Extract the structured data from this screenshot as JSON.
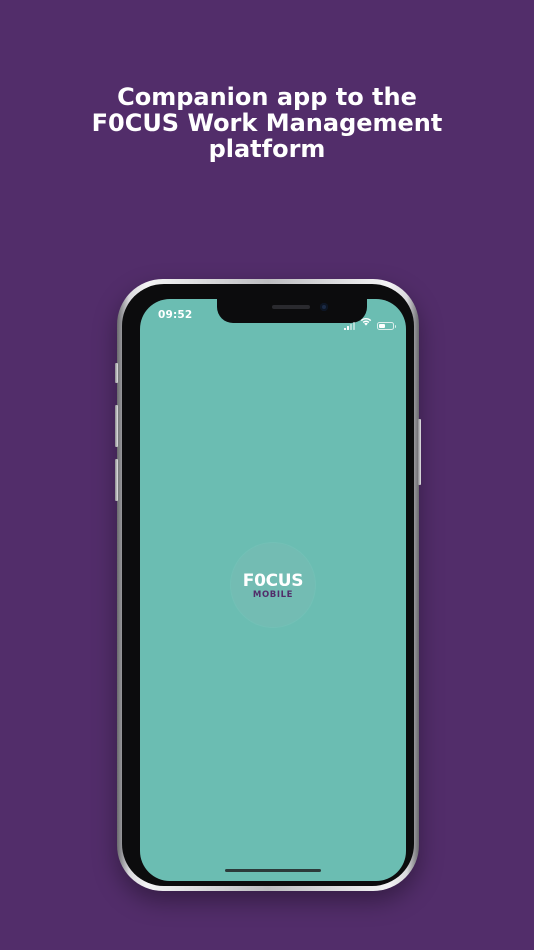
{
  "headline": {
    "line1": "Companion app to the",
    "line2": "F0CUS Work Management",
    "line3": "platform"
  },
  "status_bar": {
    "time": "09:52",
    "icons": [
      "signal-icon",
      "wifi-icon",
      "battery-icon"
    ],
    "battery_level": 0.45
  },
  "logo": {
    "main": "F0CUS",
    "sub": "MOBILE"
  },
  "colors": {
    "background": "#522d6a",
    "screen": "#6bbdb2",
    "logo_text": "#ffffff",
    "logo_sub": "#522d6a"
  }
}
